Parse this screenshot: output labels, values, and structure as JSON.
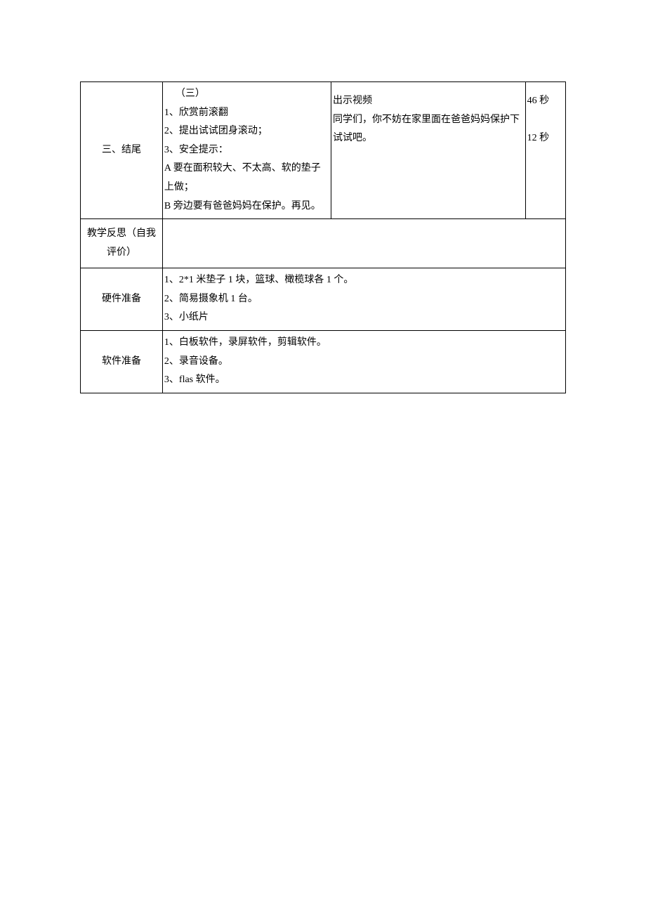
{
  "rows": [
    {
      "label": "三、结尾",
      "content": {
        "lines": [
          "（三）",
          "1、欣赏前滚翻",
          "2、提出试试团身滚动；",
          "3、安全提示：",
          "A 要在面积较大、不太高、软的垫子上做；",
          "B 旁边要有爸爸妈妈在保护。再见。"
        ]
      },
      "method": {
        "lines": [
          "出示视频",
          "同学们，你不妨在家里面在爸爸妈妈保护下试试吧。"
        ]
      },
      "time": {
        "lines": [
          "46 秒",
          "",
          "12 秒"
        ]
      }
    },
    {
      "label": "教学反思（自我评价）",
      "merged_content": ""
    },
    {
      "label": "硬件准备",
      "merged_content_lines": [
        "1、2*1 米垫子 1 块，篮球、橄榄球各 1 个。",
        "2、简易摄象机 1 台。",
        "3、小纸片"
      ]
    },
    {
      "label": "软件准备",
      "merged_content_lines": [
        "1、白板软件，录屏软件，剪辑软件。",
        "2、录音设备。",
        "3、flas 软件。"
      ]
    }
  ]
}
